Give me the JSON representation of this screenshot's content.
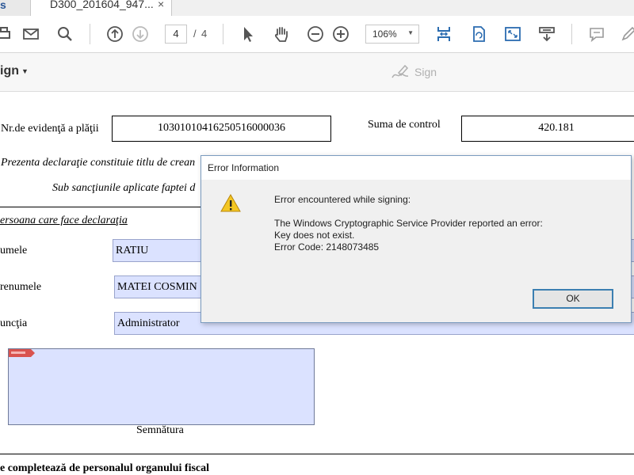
{
  "tabs": {
    "left_label": "s",
    "active_title": "D300_201604_947...",
    "close_glyph": "×"
  },
  "toolbar": {
    "page_current": "4",
    "page_separator": "/",
    "page_total": "4",
    "zoom_value": "106%",
    "accent_color": "#2b6cb0",
    "icons": [
      "print-icon",
      "email-icon",
      "search-icon",
      "page-up-icon",
      "page-down-icon",
      "select-cursor-icon",
      "hand-icon",
      "zoom-out-icon",
      "zoom-in-icon",
      "fit-width-icon",
      "rotate-icon",
      "fullscreen-icon",
      "read-mode-icon",
      "comment-icon",
      "pen-icon"
    ]
  },
  "signbar": {
    "menu_label": "ign",
    "sign_label": "Sign"
  },
  "document": {
    "nr_label": "Nr.de evidenţă a  plăţii",
    "nr_value": "10301010416250516000036",
    "suma_label": "Suma de control",
    "suma_value": "420.181",
    "prezenta_text": "Prezenta declaraţie constituie titlu de crean",
    "sub_text": "Sub sancţiunile aplicate faptei d",
    "persoana_label": "ersoana care face declaraţia",
    "numele_label": "umele",
    "numele_value": "RATIU",
    "prenumele_label": "renumele",
    "prenumele_value": "MATEI COSMIN",
    "functia_label": "uncţia",
    "functia_value": "Administrator",
    "semnatura_label": "Semnătura",
    "footer_text": "e completează de personalul organului fiscal"
  },
  "dialog": {
    "title": "Error Information",
    "line1": "Error encountered while signing:",
    "line2": "The Windows Cryptographic Service Provider reported an error:",
    "line3": "Key does not exist.",
    "line4": "Error Code: 2148073485",
    "ok_label": "OK"
  }
}
